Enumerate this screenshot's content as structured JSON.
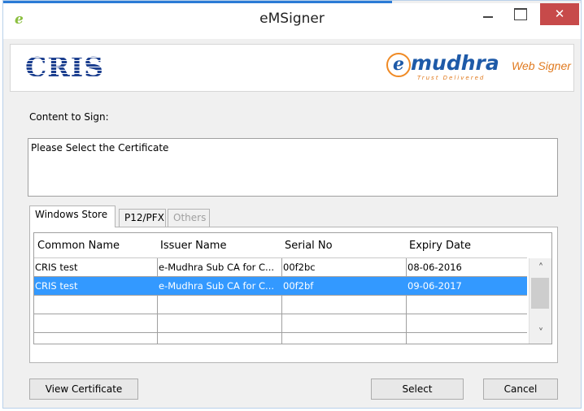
{
  "window": {
    "title": "eMSigner"
  },
  "titlebar": {
    "close_glyph": "✕",
    "app_icon": "e"
  },
  "banner": {
    "cris_logo": "CRIS",
    "emudhra_e": "e",
    "emudhra_name": "mudhra",
    "emudhra_tagline": "Trust Delivered",
    "web_signer": "Web Signer"
  },
  "content": {
    "label": "Content to Sign:",
    "text": "Please Select the Certificate"
  },
  "tabs": [
    {
      "label": "Windows Store",
      "active": true
    },
    {
      "label": "P12/PFX",
      "active": false
    },
    {
      "label": "Others",
      "active": false,
      "disabled": true
    }
  ],
  "table": {
    "columns": [
      "Common Name",
      "Issuer Name",
      "Serial No",
      "Expiry Date"
    ],
    "rows": [
      {
        "common_name": "CRIS test",
        "issuer": "e-Mudhra Sub CA for C...",
        "serial": "00f2bc",
        "expiry": "08-06-2016",
        "selected": false
      },
      {
        "common_name": "CRIS test",
        "issuer": "e-Mudhra Sub CA for C...",
        "serial": "00f2bf",
        "expiry": "09-06-2017",
        "selected": true
      }
    ]
  },
  "scrollbar": {
    "up_glyph": "˄",
    "down_glyph": "˅"
  },
  "buttons": {
    "view_certificate": "View Certificate",
    "select": "Select",
    "cancel": "Cancel"
  },
  "colors": {
    "selection": "#3399ff",
    "close_button": "#c74a4a",
    "accent": "#2b7bd6"
  }
}
